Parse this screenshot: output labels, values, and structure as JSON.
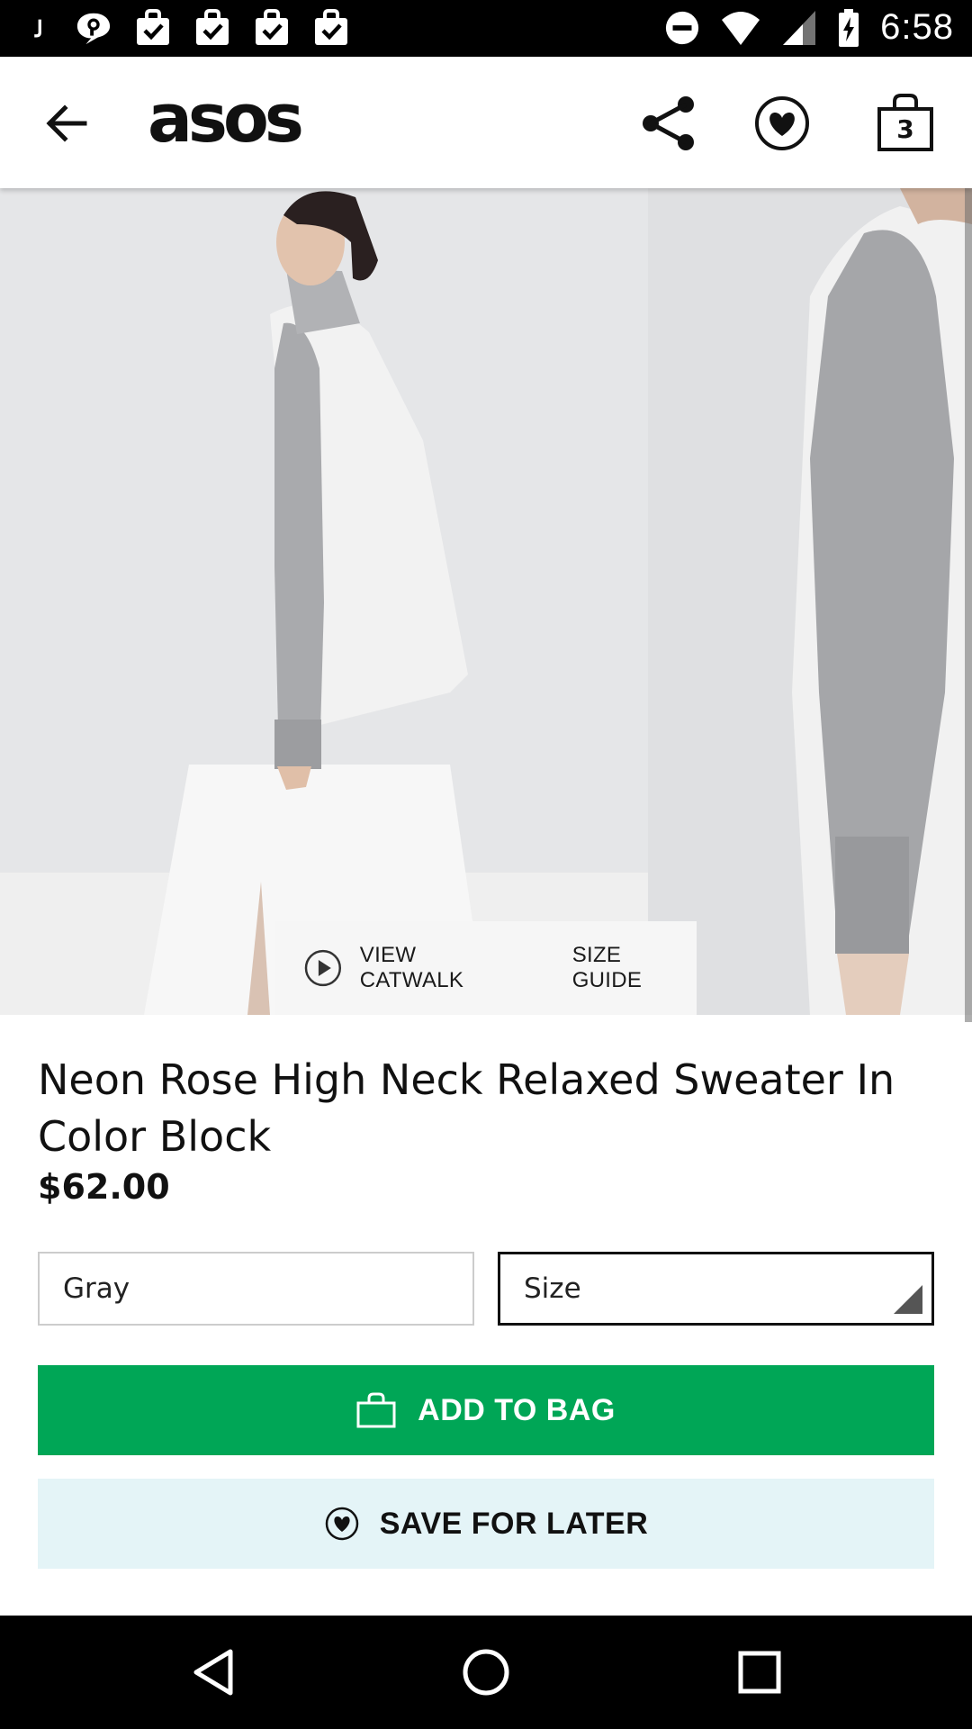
{
  "status_bar": {
    "time": "6:58",
    "left_icons": [
      "j-app-icon",
      "chat-icon",
      "bag-check-icon",
      "bag-check-icon",
      "bag-check-icon",
      "bag-check-icon"
    ],
    "right_icons": [
      "do-not-disturb-icon",
      "wifi-icon",
      "signal-icon",
      "battery-charging-icon"
    ]
  },
  "header": {
    "logo": "asos",
    "bag_count": "3",
    "icons": [
      "back-arrow-icon",
      "share-icon",
      "heart-circle-icon",
      "shopping-bag-icon"
    ]
  },
  "gallery": {
    "view_catwalk": "VIEW CATWALK",
    "size_guide": "SIZE GUIDE"
  },
  "product": {
    "title": "Neon Rose High Neck Relaxed Sweater In Color Block",
    "price": "$62.00",
    "color_value": "Gray",
    "size_placeholder": "Size"
  },
  "actions": {
    "add_to_bag": "ADD TO BAG",
    "save_for_later": "SAVE FOR LATER"
  },
  "colors": {
    "add_to_bag_bg": "#00a656",
    "save_for_later_bg": "#e4f4f7",
    "status_bar_bg": "#000000"
  },
  "nav_bar": {
    "icons": [
      "nav-back-icon",
      "nav-home-icon",
      "nav-recents-icon"
    ]
  }
}
